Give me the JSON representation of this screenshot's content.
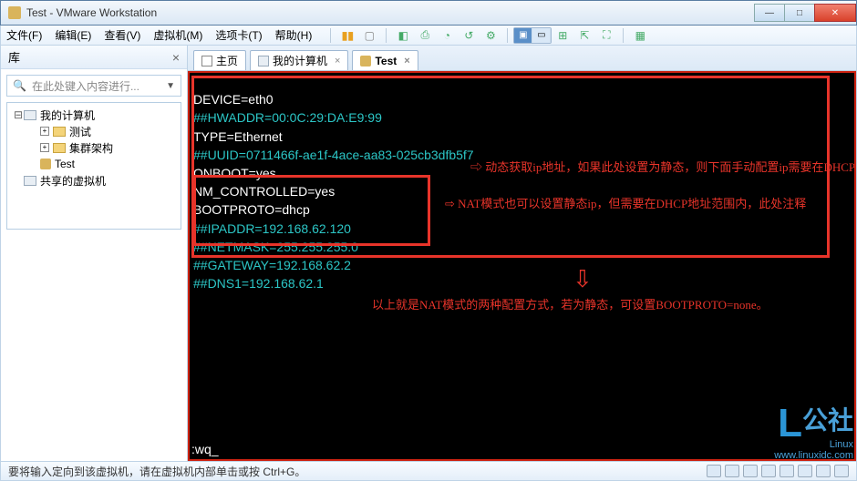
{
  "window": {
    "title": "Test - VMware Workstation"
  },
  "menu": {
    "file": "文件(F)",
    "edit": "编辑(E)",
    "view": "查看(V)",
    "vm": "虚拟机(M)",
    "tabs": "选项卡(T)",
    "help": "帮助(H)"
  },
  "sidebar": {
    "title": "库",
    "search_placeholder": "在此处键入内容进行...",
    "root": "我的计算机",
    "items": [
      "测试",
      "集群架构",
      "Test"
    ],
    "shared": "共享的虚拟机"
  },
  "tabs": {
    "home": "主页",
    "mycomputer": "我的计算机",
    "test": "Test"
  },
  "terminal": {
    "line1": "DEVICE=eth0",
    "line2": "##HWADDR=00:0C:29:DA:E9:99",
    "line3": "TYPE=Ethernet",
    "line4": "##UUID=0711466f-ae1f-4ace-aa83-025cb3dfb5f7",
    "line5": "ONBOOT=yes",
    "line6": "NM_CONTROLLED=yes",
    "line7": "BOOTPROTO=dhcp",
    "line8": "##IPADDR=192.168.62.120",
    "line9": "##NETMASK=255.255.255.0",
    "line10": "##GATEWAY=192.168.62.2",
    "line11": "##DNS1=192.168.62.1",
    "anno1": "⇨ 动态获取ip地址，如果此处设置为静态，则下面手动配置ip需要在DHCP地址范围内",
    "anno2": "⇨ NAT模式也可以设置静态ip，但需要在DHCP地址范围内，此处注释",
    "summary": "以上就是NAT模式的两种配置方式，若为静态，可设置BOOTPROTO=none。",
    "wq": ":wq_"
  },
  "statusbar": {
    "text": "要将输入定向到该虚拟机，请在虚拟机内部单击或按 Ctrl+G。"
  },
  "watermark": {
    "brand": "公社",
    "sub": "Linux",
    "url": "www.linuxidc.com"
  }
}
